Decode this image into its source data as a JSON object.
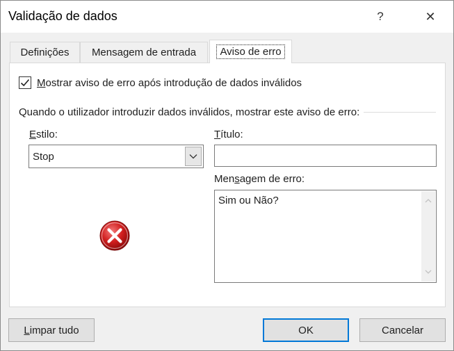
{
  "dialog": {
    "title": "Validação de dados",
    "help_glyph": "?",
    "close_glyph": "✕"
  },
  "tabs": [
    {
      "label": "Definições",
      "active": false
    },
    {
      "label": "Mensagem de entrada",
      "active": false
    },
    {
      "label": "Aviso de erro",
      "active": true
    }
  ],
  "error_tab": {
    "show_alert_checkbox": {
      "label_prefix": "M",
      "label_rest": "ostrar aviso de erro após introdução de dados inválidos",
      "checked": true
    },
    "section_label": "Quando o utilizador introduzir dados inválidos, mostrar este aviso de erro:",
    "style": {
      "label_prefix": "E",
      "label_rest": "stilo:",
      "value": "Stop"
    },
    "title": {
      "label_prefix": "T",
      "label_rest": "ítulo:",
      "value": ""
    },
    "error_message": {
      "label_pre": "Men",
      "label_key": "s",
      "label_post": "agem de erro:",
      "value": "Sim ou Não?"
    }
  },
  "buttons": {
    "clear_prefix": "L",
    "clear_rest": "impar tudo",
    "ok": "OK",
    "cancel": "Cancelar"
  },
  "colors": {
    "accent": "#0078d7",
    "stop_red": "#d11f1f"
  },
  "icons": {
    "style_icon": "stop-icon",
    "select_arrow": "chevron-down-icon"
  }
}
